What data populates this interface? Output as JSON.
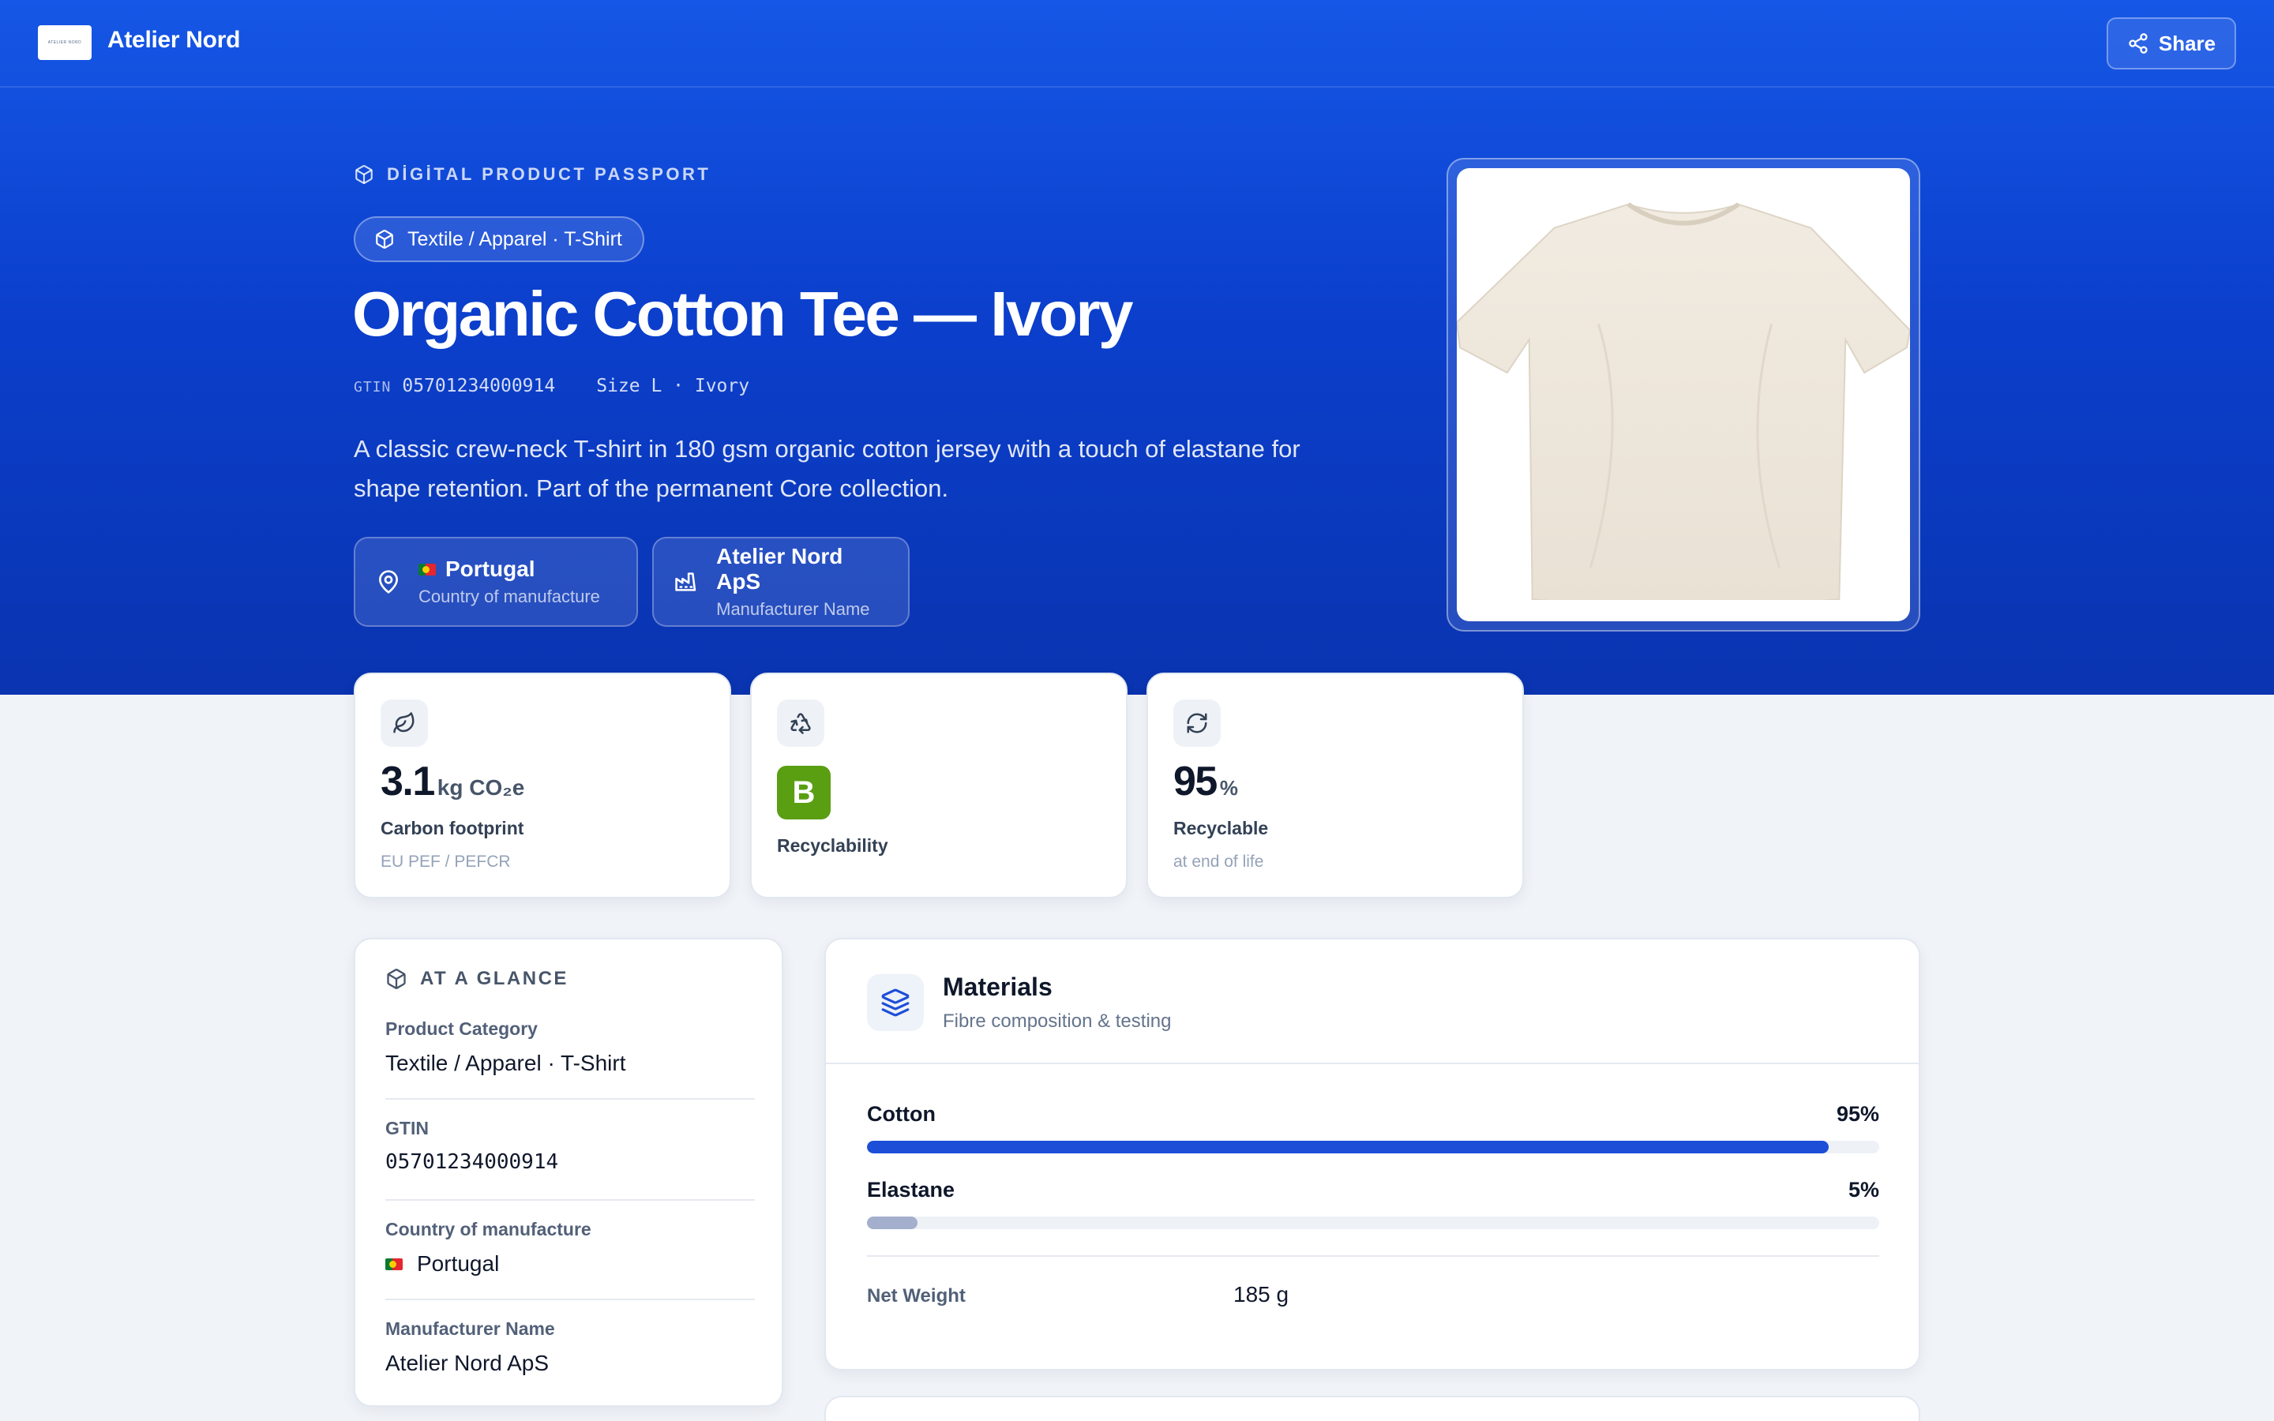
{
  "header": {
    "logo_text": "ATELIER NORD",
    "brand": "Atelier Nord",
    "share_label": "Share"
  },
  "hero": {
    "eyebrow": "DİGİTAL PRODUCT PASSPORT",
    "category": "Textile / Apparel · T-Shirt",
    "title": "Organic Cotton Tee — Ivory",
    "gtin_tag": "GTIN",
    "gtin": "05701234000914",
    "variant": "Size L · Ivory",
    "description": "A classic crew-neck T-shirt in 180 gsm organic cotton jersey with a touch of elastane for shape retention. Part of the permanent Core collection.",
    "country": {
      "value": "Portugal",
      "label": "Country of manufacture"
    },
    "manufacturer": {
      "value": "Atelier Nord ApS",
      "label": "Manufacturer Name"
    }
  },
  "metrics": {
    "carbon": {
      "value": "3.1",
      "unit": "kg CO₂e",
      "label": "Carbon footprint",
      "sub": "EU PEF / PEFCR"
    },
    "recyclability": {
      "grade": "B",
      "label": "Recyclability",
      "grade_color": "#5a9e12"
    },
    "recyclable": {
      "value": "95",
      "unit": "%",
      "label": "Recyclable",
      "sub": "at end of life"
    }
  },
  "glance": {
    "heading": "AT A GLANCE",
    "rows": [
      {
        "key": "Product Category",
        "value": "Textile / Apparel · T-Shirt"
      },
      {
        "key": "GTIN",
        "value": "05701234000914"
      },
      {
        "key": "Country of manufacture",
        "value": "Portugal"
      },
      {
        "key": "Manufacturer Name",
        "value": "Atelier Nord ApS"
      }
    ]
  },
  "materials": {
    "title": "Materials",
    "subtitle": "Fibre composition & testing",
    "fibres": [
      {
        "name": "Cotton",
        "percent_label": "95%",
        "fraction": 0.95,
        "color": "#1d4ed8"
      },
      {
        "name": "Elastane",
        "percent_label": "5%",
        "fraction": 0.05,
        "color": "#a3afcc"
      }
    ],
    "net_weight_label": "Net Weight",
    "net_weight_value": "185 g"
  },
  "colors": {
    "accent": "#1657e6",
    "hero_dark": "#0a34b0"
  }
}
